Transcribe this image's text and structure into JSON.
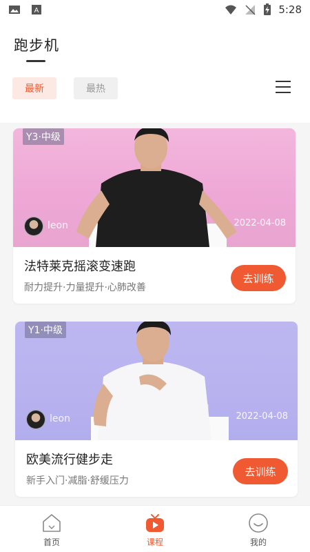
{
  "status_bar": {
    "time": "5:28",
    "icons": [
      "image-icon",
      "font-icon",
      "wifi-icon",
      "no-signal-icon",
      "battery-charging-icon"
    ]
  },
  "header": {
    "title": "跑步机",
    "tabs": [
      {
        "label": "最新",
        "active": true
      },
      {
        "label": "最热",
        "active": false
      }
    ],
    "menu_icon": "menu-icon"
  },
  "courses": [
    {
      "level": "Y3·中级",
      "author": "leon",
      "date": "2022-04-08",
      "title": "法特莱克摇滚变速跑",
      "tags": "耐力提升·力量提升·心肺改善",
      "button": "去训练",
      "banner_color": "#eea7d6"
    },
    {
      "level": "Y1·中级",
      "author": "leon",
      "date": "2022-04-08",
      "title": "欧美流行健步走",
      "tags": "新手入门·减脂·舒缓压力",
      "button": "去训练",
      "banner_color": "#b8b2ef"
    }
  ],
  "bottom_nav": [
    {
      "label": "首页",
      "icon": "home-icon",
      "active": false
    },
    {
      "label": "课程",
      "icon": "course-tv-icon",
      "active": true
    },
    {
      "label": "我的",
      "icon": "profile-smile-icon",
      "active": false
    }
  ],
  "colors": {
    "accent": "#f05a32",
    "tab_active_bg": "#fde9e3"
  }
}
